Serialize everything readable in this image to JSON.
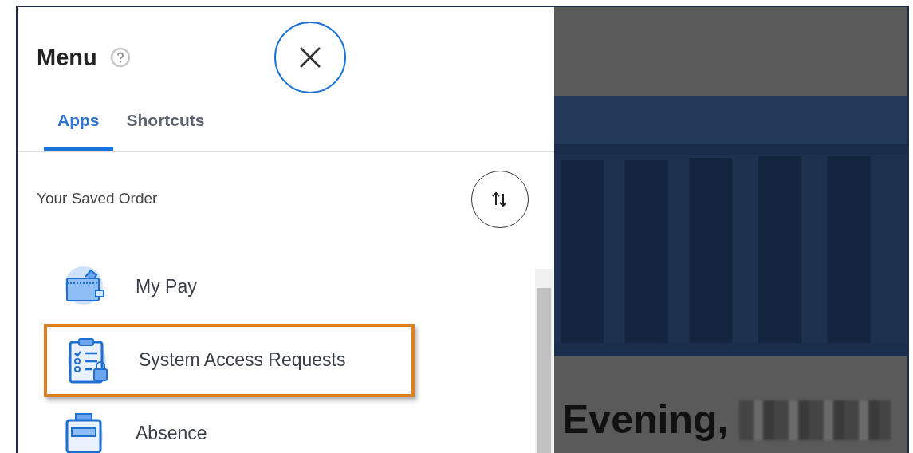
{
  "menu": {
    "title": "Menu"
  },
  "tabs": [
    {
      "label": "Apps",
      "selected": true
    },
    {
      "label": "Shortcuts",
      "selected": false
    }
  ],
  "section_label": "Your Saved Order",
  "apps": [
    {
      "name": "My Pay",
      "kind": "wallet",
      "highlighted": false
    },
    {
      "name": "System Access Requests",
      "kind": "clipboard",
      "highlighted": true
    },
    {
      "name": "Absence",
      "kind": "case",
      "highlighted": false
    }
  ],
  "background": {
    "greeting": "Evening,",
    "name_redacted": true
  }
}
